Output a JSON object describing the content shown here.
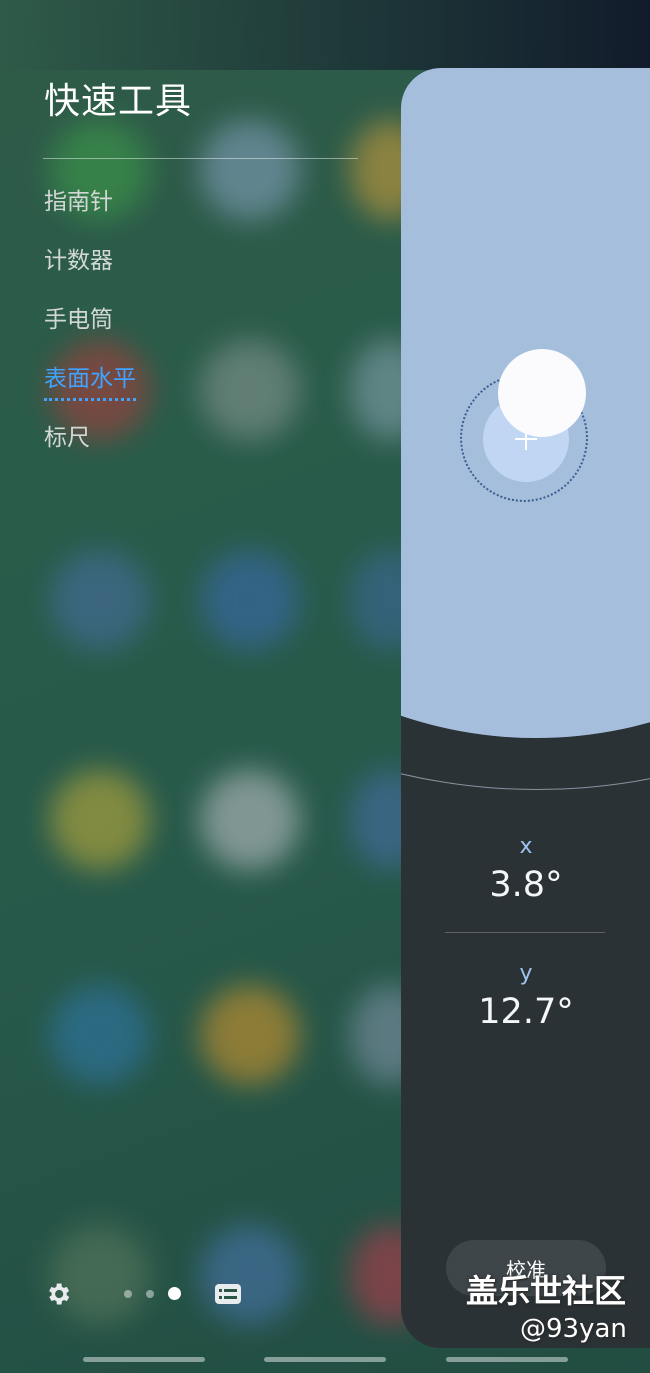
{
  "panel": {
    "title": "快速工具",
    "menu": [
      {
        "label": "指南针",
        "active": false
      },
      {
        "label": "计数器",
        "active": false
      },
      {
        "label": "手电筒",
        "active": false
      },
      {
        "label": "表面水平",
        "active": true
      },
      {
        "label": "标尺",
        "active": false
      }
    ]
  },
  "bottom_bar": {
    "settings_icon": "gear-icon",
    "page_count": 3,
    "current_page": 3,
    "list_icon": "list-icon"
  },
  "level": {
    "x_label": "x",
    "x_value": "3.8°",
    "y_label": "y",
    "y_value": "12.7°",
    "calibrate_label": "校准"
  },
  "watermark": {
    "line1": "盖乐世社区",
    "line2": "@93yan"
  },
  "colors": {
    "accent": "#3fa3ff",
    "level_face": "#a4bedc",
    "level_panel": "#2b3236",
    "axis_label": "#9fc4ec"
  }
}
